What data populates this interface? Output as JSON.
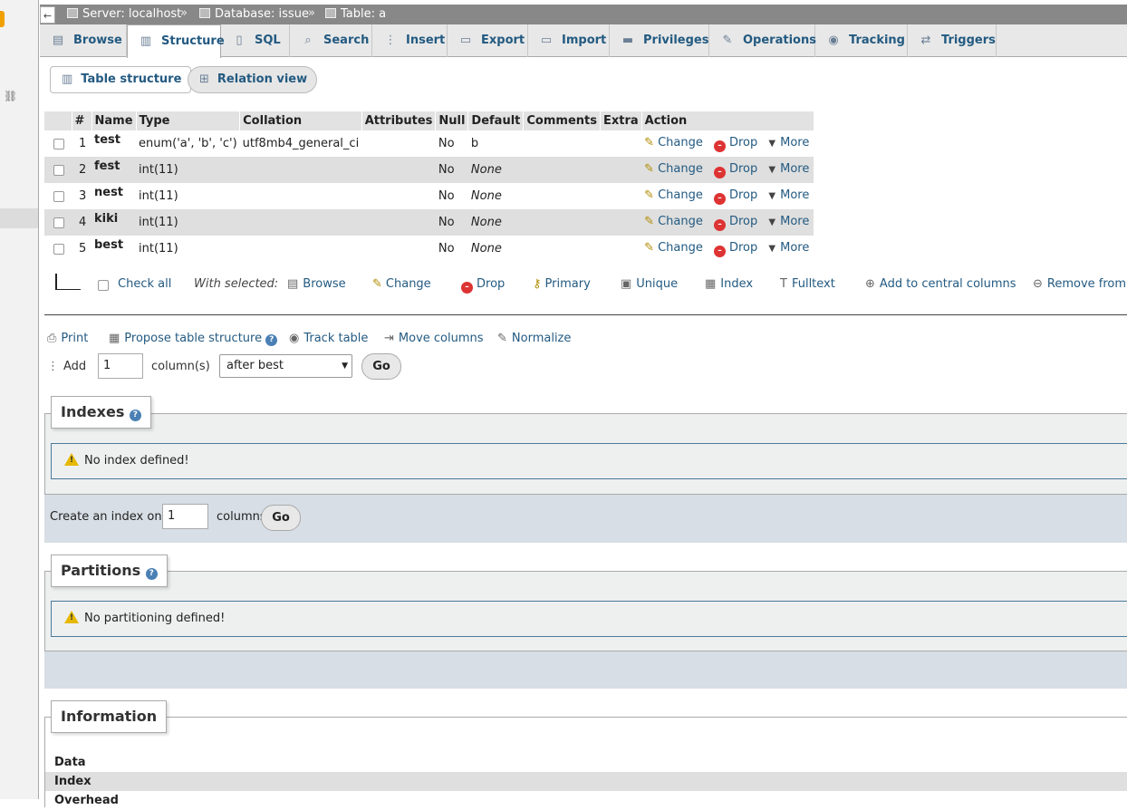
{
  "breadcrumb": {
    "back": "←",
    "server": "Server: localhost",
    "database": "Database: issue",
    "table": "Table: a",
    "sep": "»"
  },
  "tabs": [
    {
      "label": "Browse",
      "icon": "browse-icon"
    },
    {
      "label": "Structure",
      "icon": "structure-icon"
    },
    {
      "label": "SQL",
      "icon": "sql-icon"
    },
    {
      "label": "Search",
      "icon": "search-icon"
    },
    {
      "label": "Insert",
      "icon": "insert-icon"
    },
    {
      "label": "Export",
      "icon": "export-icon"
    },
    {
      "label": "Import",
      "icon": "import-icon"
    },
    {
      "label": "Privileges",
      "icon": "privileges-icon"
    },
    {
      "label": "Operations",
      "icon": "wrench-icon"
    },
    {
      "label": "Tracking",
      "icon": "eye-icon"
    },
    {
      "label": "Triggers",
      "icon": "triggers-icon"
    }
  ],
  "subtabs": {
    "table_structure": "Table structure",
    "relation_view": "Relation view"
  },
  "columns_table": {
    "headers": [
      "#",
      "Name",
      "Type",
      "Collation",
      "Attributes",
      "Null",
      "Default",
      "Comments",
      "Extra",
      "Action"
    ],
    "rows": [
      {
        "num": "1",
        "name": "test",
        "type": "enum('a', 'b', 'c')",
        "collation": "utf8mb4_general_ci",
        "attributes": "",
        "null": "No",
        "default": "b",
        "comments": "",
        "extra": ""
      },
      {
        "num": "2",
        "name": "fest",
        "type": "int(11)",
        "collation": "",
        "attributes": "",
        "null": "No",
        "default": "None",
        "comments": "",
        "extra": ""
      },
      {
        "num": "3",
        "name": "nest",
        "type": "int(11)",
        "collation": "",
        "attributes": "",
        "null": "No",
        "default": "None",
        "comments": "",
        "extra": ""
      },
      {
        "num": "4",
        "name": "kiki",
        "type": "int(11)",
        "collation": "",
        "attributes": "",
        "null": "No",
        "default": "None",
        "comments": "",
        "extra": ""
      },
      {
        "num": "5",
        "name": "best",
        "type": "int(11)",
        "collation": "",
        "attributes": "",
        "null": "No",
        "default": "None",
        "comments": "",
        "extra": ""
      }
    ],
    "action_labels": {
      "change": "Change",
      "drop": "Drop",
      "more": "More"
    }
  },
  "with_selected": {
    "check_all": "Check all",
    "label": "With selected:",
    "browse": "Browse",
    "change": "Change",
    "drop": "Drop",
    "primary": "Primary",
    "unique": "Unique",
    "index": "Index",
    "fulltext": "Fulltext",
    "add_central": "Add to central columns",
    "remove_central": "Remove from c"
  },
  "tools": {
    "print": "Print",
    "propose": "Propose table structure",
    "track": "Track table",
    "move": "Move columns",
    "normalize": "Normalize"
  },
  "add_columns": {
    "add_label": "Add",
    "count_value": "1",
    "columns_label": "column(s)",
    "position_selected": "after best",
    "go": "Go"
  },
  "indexes": {
    "legend": "Indexes",
    "notice": "No index defined!",
    "create_label": "Create an index on",
    "create_value": "1",
    "columns_label": "columns",
    "go": "Go"
  },
  "partitions": {
    "legend": "Partitions",
    "notice": "No partitioning defined!"
  },
  "information": {
    "legend": "Information",
    "rows": [
      "Data",
      "Index",
      "Overhead"
    ]
  },
  "colors": {
    "link": "#235a81",
    "tab_bg": "#e8e8e8",
    "breadcrumb_bg": "#888888",
    "row_alt": "#dfdfdf"
  }
}
